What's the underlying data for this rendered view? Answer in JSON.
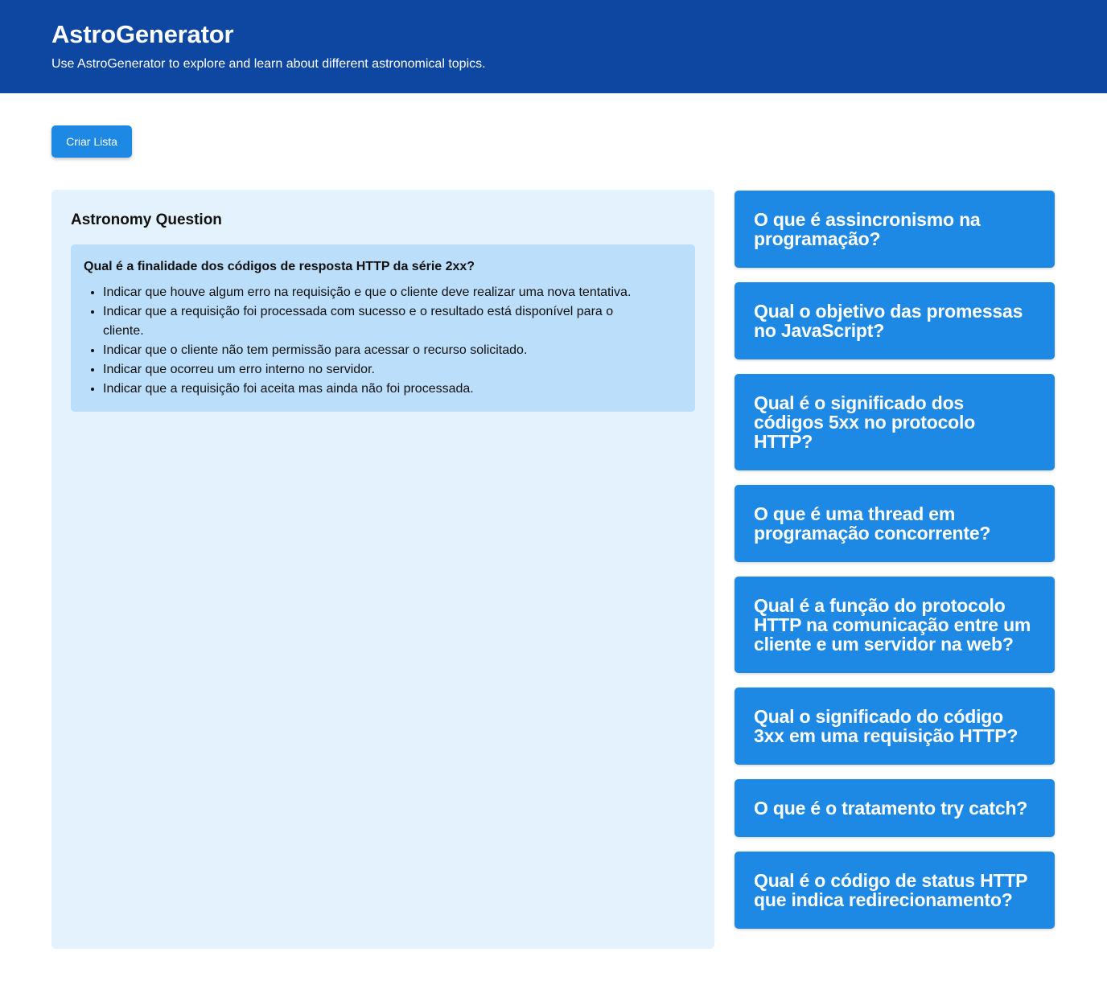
{
  "header": {
    "title": "AstroGenerator",
    "subtitle": "Use AstroGenerator to explore and learn about different astronomical topics."
  },
  "toolbar": {
    "create_list_label": "Criar Lista"
  },
  "question_panel": {
    "heading": "Astronomy Question",
    "question": "Qual é a finalidade dos códigos de resposta HTTP da série 2xx?",
    "options": [
      "Indicar que houve algum erro na requisição e que o cliente deve realizar uma nova tentativa.",
      "Indicar que a requisição foi processada com sucesso e o resultado está disponível para o cliente.",
      "Indicar que o cliente não tem permissão para acessar o recurso solicitado.",
      "Indicar que ocorreu um erro interno no servidor.",
      "Indicar que a requisição foi aceita mas ainda não foi processada."
    ]
  },
  "sidebar": {
    "topics": [
      "O que é assincronismo na programação?",
      "Qual o objetivo das promessas no JavaScript?",
      "Qual é o significado dos códigos 5xx no protocolo HTTP?",
      "O que é uma thread em programação concorrente?",
      "Qual é a função do protocolo HTTP na comunicação entre um cliente e um servidor na web?",
      "Qual o significado do código 3xx em uma requisição HTTP?",
      "O que é o tratamento try catch?",
      "Qual é o código de status HTTP que indica redirecionamento?"
    ]
  },
  "colors": {
    "header_bg": "#0d47a1",
    "accent": "#1e88e5",
    "panel_bg": "#e3f2fd",
    "card_bg": "#bbdefb"
  }
}
